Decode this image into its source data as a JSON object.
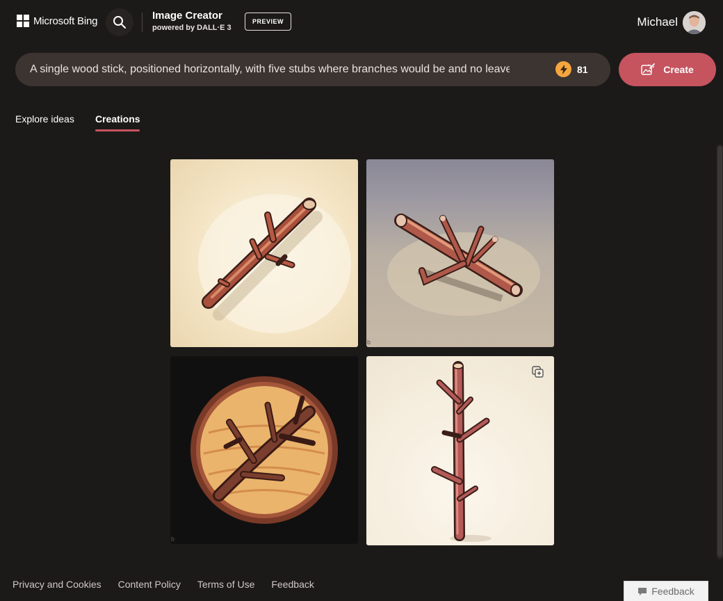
{
  "header": {
    "brand": "Microsoft Bing",
    "product_title": "Image Creator",
    "product_subtitle": "powered by DALL·E 3",
    "badge": "PREVIEW",
    "user_name": "Michael"
  },
  "prompt": {
    "value": "A single wood stick, positioned horizontally, with five stubs where branches would be and no leaves",
    "boosts": "81",
    "create_label": "Create"
  },
  "tabs": [
    {
      "label": "Explore ideas",
      "active": false
    },
    {
      "label": "Creations",
      "active": true
    }
  ],
  "images": [
    {
      "icon": "diagonal-stick-image"
    },
    {
      "icon": "stick-on-ground-image"
    },
    {
      "icon": "round-emblem-branch-image"
    },
    {
      "icon": "vertical-stick-image"
    }
  ],
  "footer": {
    "links": [
      "Privacy and Cookies",
      "Content Policy",
      "Terms of Use",
      "Feedback"
    ],
    "feedback_button": "Feedback"
  },
  "colors": {
    "background": "#1c1a19",
    "accent": "#c5545f",
    "prompt_bg": "#3c3431",
    "boost": "#f5a63d"
  }
}
